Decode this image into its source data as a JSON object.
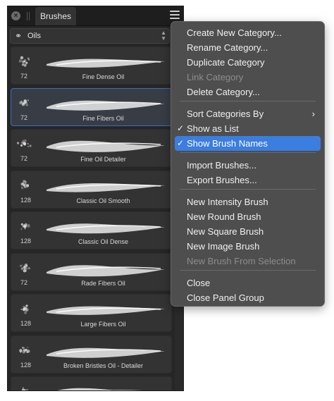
{
  "panel": {
    "tab_label": "Brushes",
    "category": "Oils",
    "brushes": [
      {
        "size": "72",
        "name": "Fine Dense Oil"
      },
      {
        "size": "72",
        "name": "Fine Fibers Oil"
      },
      {
        "size": "72",
        "name": "Fine Oil Detailer"
      },
      {
        "size": "128",
        "name": "Classic Oil Smooth"
      },
      {
        "size": "128",
        "name": "Classic Oil Dense"
      },
      {
        "size": "72",
        "name": "Rade Fibers Oil"
      },
      {
        "size": "128",
        "name": "Large Fibers Oil"
      },
      {
        "size": "128",
        "name": "Broken Bristles Oil - Detailer"
      },
      {
        "size": "",
        "name": ""
      }
    ],
    "selected_index": 1
  },
  "menu": {
    "items": [
      {
        "label": "Create New Category...",
        "enabled": true
      },
      {
        "label": "Rename Category...",
        "enabled": true
      },
      {
        "label": "Duplicate Category",
        "enabled": true
      },
      {
        "label": "Link Category",
        "enabled": false
      },
      {
        "label": "Delete Category...",
        "enabled": true
      },
      {
        "label": "Sort Categories By",
        "enabled": true,
        "submenu": true
      },
      {
        "label": "Show as List",
        "enabled": true,
        "checked": true
      },
      {
        "label": "Show Brush Names",
        "enabled": true,
        "checked": true,
        "highlighted": true
      },
      {
        "label": "Import Brushes...",
        "enabled": true
      },
      {
        "label": "Export Brushes...",
        "enabled": true
      },
      {
        "label": "New Intensity Brush",
        "enabled": true
      },
      {
        "label": "New Round Brush",
        "enabled": true
      },
      {
        "label": "New Square Brush",
        "enabled": true
      },
      {
        "label": "New Image Brush",
        "enabled": true
      },
      {
        "label": "New Brush From Selection",
        "enabled": false
      },
      {
        "label": "Close",
        "enabled": true
      },
      {
        "label": "Close Panel Group",
        "enabled": true
      }
    ],
    "check_glyph": "✓",
    "submenu_glyph": "›"
  },
  "colors": {
    "highlight": "#3b7de0",
    "selected_border": "#3a6cc4"
  }
}
